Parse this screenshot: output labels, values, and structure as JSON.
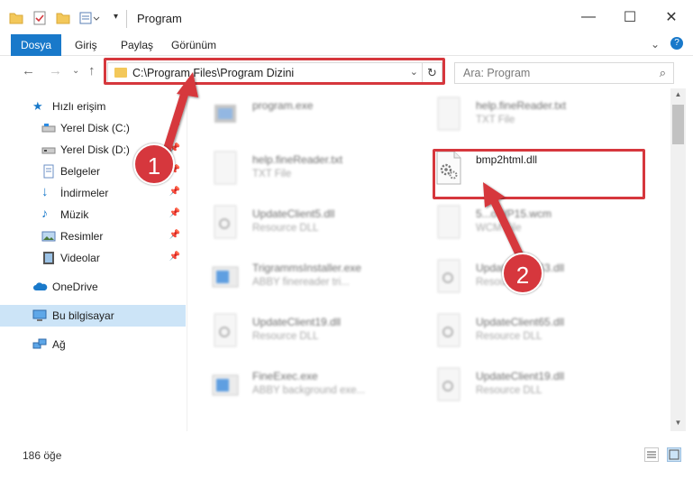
{
  "window": {
    "title": "Program",
    "minimize_icon": "minimize-icon",
    "maximize_icon": "maximize-icon",
    "close_icon": "close-icon"
  },
  "ribbon": {
    "tabs": [
      "Dosya",
      "Giriş",
      "Paylaş",
      "Görünüm"
    ],
    "accent": "#1979ca"
  },
  "address": {
    "path": "C:\\Program Files\\Program Dizini",
    "search_placeholder": "Ara: Program"
  },
  "sidebar": {
    "items": [
      {
        "label": "Hızlı erişim",
        "icon": "star-icon",
        "pinned": false
      },
      {
        "label": "Yerel Disk (C:)",
        "icon": "drive-icon",
        "pinned": true
      },
      {
        "label": "Yerel Disk (D:)",
        "icon": "drive-icon",
        "pinned": true
      },
      {
        "label": "Belgeler",
        "icon": "documents-icon",
        "pinned": true
      },
      {
        "label": "İndirmeler",
        "icon": "download-icon",
        "pinned": true
      },
      {
        "label": "Müzik",
        "icon": "music-icon",
        "pinned": true
      },
      {
        "label": "Resimler",
        "icon": "pictures-icon",
        "pinned": true
      },
      {
        "label": "Videolar",
        "icon": "video-icon",
        "pinned": true
      },
      {
        "label": "OneDrive",
        "icon": "cloud-icon",
        "pinned": false
      },
      {
        "label": "Bu bilgisayar",
        "icon": "computer-icon",
        "pinned": false
      },
      {
        "label": "Ağ",
        "icon": "network-icon",
        "pinned": false
      }
    ]
  },
  "files": [
    {
      "name": "program.exe",
      "type": ""
    },
    {
      "name": "help.fineReader.txt",
      "type": "TXT File"
    },
    {
      "name": "help.fineReader.txt",
      "type": "TXT File"
    },
    {
      "name": "bmp2html.dll",
      "type": ""
    },
    {
      "name": "UpdateClient5.dll",
      "type": "Resource DLL"
    },
    {
      "name": "5...oWP15.wcm",
      "type": "WCM File"
    },
    {
      "name": "TrigrammsInstaller.exe",
      "type": "ABBY finereader tri..."
    },
    {
      "name": "UpdateClient63.dll",
      "type": "Resource DLL"
    },
    {
      "name": "UpdateClient19.dll",
      "type": "Resource DLL"
    },
    {
      "name": "UpdateClient65.dll",
      "type": "Resource DLL"
    },
    {
      "name": "FineExec.exe",
      "type": "ABBY background exe..."
    },
    {
      "name": "UpdateClient19.dll",
      "type": "Resource DLL"
    }
  ],
  "status": {
    "count": "186 öğe"
  },
  "callouts": [
    "1",
    "2"
  ],
  "colors": {
    "highlight": "#d6373d",
    "selected": "#cce4f7"
  }
}
